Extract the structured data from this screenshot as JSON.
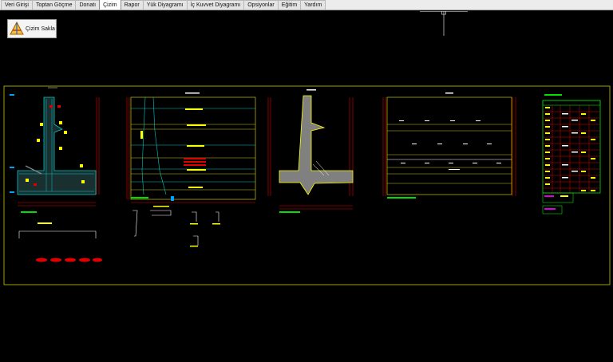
{
  "tabs": [
    {
      "label": "Veri Girişi"
    },
    {
      "label": "Toptan Göçme"
    },
    {
      "label": "Donatı"
    },
    {
      "label": "Çizim"
    },
    {
      "label": "Rapor"
    },
    {
      "label": "Yük Diyagramı"
    },
    {
      "label": "İç Kuvvet Diyagramı"
    },
    {
      "label": "Opsiyonlar"
    },
    {
      "label": "Eğitim"
    },
    {
      "label": "Yardım"
    }
  ],
  "active_tab": "Çizim",
  "toolbar": {
    "save_label": "Çizim Sakla",
    "save_icon": "drawing-compass-icon"
  },
  "colors": {
    "frame": "#c8c800",
    "cyan": "#00c8c8",
    "red": "#e00000",
    "yellow": "#ffff00",
    "green": "#00e000",
    "magenta": "#e000e0",
    "gray": "#808080",
    "white": "#ffffff"
  }
}
